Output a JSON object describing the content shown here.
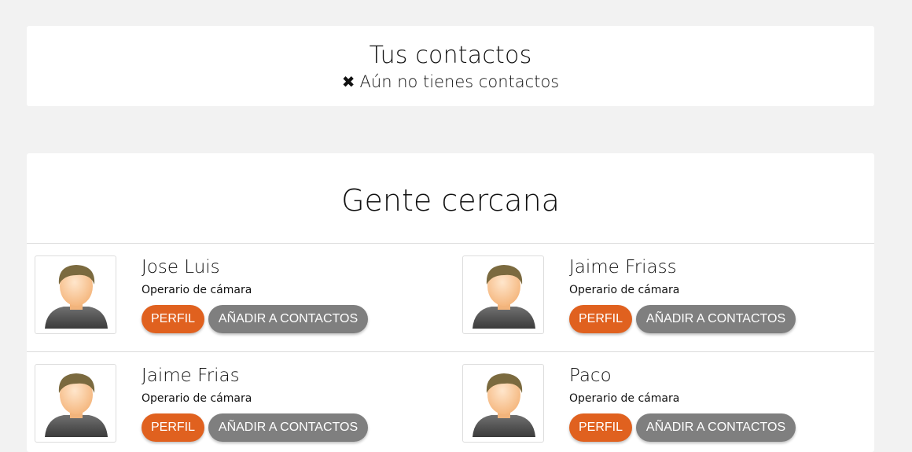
{
  "contacts": {
    "title": "Tus contactos",
    "empty_icon": "close-icon",
    "empty_message": "Aún no tienes contactos"
  },
  "nearby": {
    "title": "Gente cercana",
    "people": [
      {
        "name": "Jose Luis",
        "role": "Operario de cámara",
        "profile_label": "PERFIL",
        "add_label": "AÑADIR A CONTACTOS"
      },
      {
        "name": "Jaime Friass",
        "role": "Operario de cámara",
        "profile_label": "PERFIL",
        "add_label": "AÑADIR A CONTACTOS"
      },
      {
        "name": "Jaime Frias",
        "role": "Operario de cámara",
        "profile_label": "PERFIL",
        "add_label": "AÑADIR A CONTACTOS"
      },
      {
        "name": "Paco",
        "role": "Operario de cámara",
        "profile_label": "PERFIL",
        "add_label": "AÑADIR A CONTACTOS"
      }
    ]
  },
  "colors": {
    "profile_button": "#e0611f",
    "add_button": "#7f7f7f",
    "background": "#f2f2f2"
  }
}
